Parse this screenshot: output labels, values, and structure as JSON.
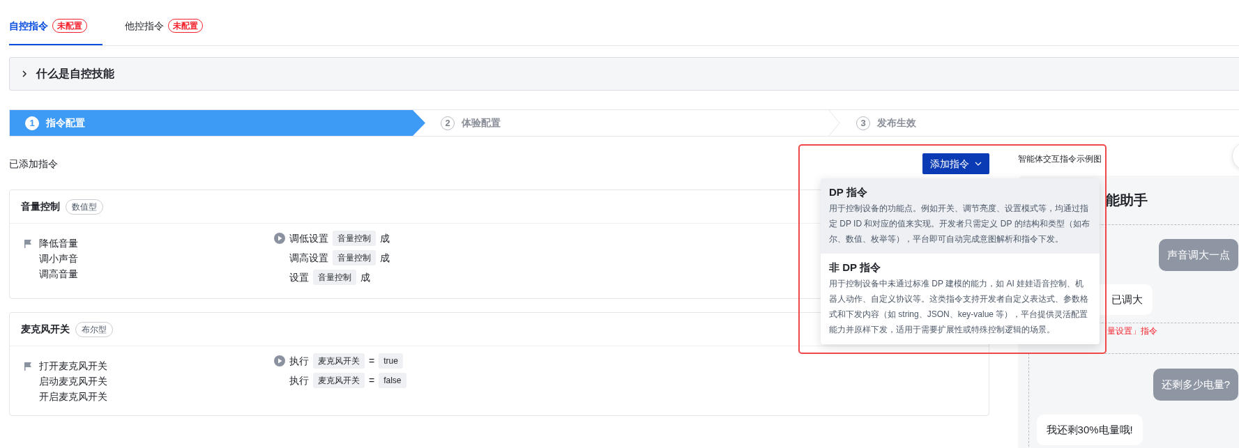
{
  "tabs": [
    {
      "label": "自控指令",
      "badge": "未配置",
      "selected": true
    },
    {
      "label": "他控指令",
      "badge": "未配置",
      "selected": false
    }
  ],
  "collapse": {
    "title": "什么是自控技能",
    "expanded": false
  },
  "steps": [
    {
      "number": "1",
      "label": "指令配置",
      "selected": true
    },
    {
      "number": "2",
      "label": "体验配置",
      "selected": false
    },
    {
      "number": "3",
      "label": "发布生效",
      "selected": false
    }
  ],
  "section_title": "已添加指令",
  "add_button": {
    "label": "添加指令"
  },
  "commands": [
    {
      "name": "音量控制",
      "type": "数值型",
      "utterances": [
        "降低音量",
        "调小声音",
        "调高音量"
      ],
      "actions": [
        [
          {
            "kind": "text",
            "text": "调低设置"
          },
          {
            "kind": "chip",
            "text": "音量控制"
          },
          {
            "kind": "text",
            "text": "成"
          }
        ],
        [
          {
            "kind": "text",
            "text": "调高设置"
          },
          {
            "kind": "chip",
            "text": "音量控制"
          },
          {
            "kind": "text",
            "text": "成"
          }
        ],
        [
          {
            "kind": "text",
            "text": "设置"
          },
          {
            "kind": "chip",
            "text": "音量控制"
          },
          {
            "kind": "text",
            "text": "成"
          }
        ]
      ]
    },
    {
      "name": "麦克风开关",
      "type": "布尔型",
      "utterances": [
        "打开麦克风开关",
        "启动麦克风开关",
        "开启麦克风开关"
      ],
      "actions": [
        [
          {
            "kind": "text",
            "text": "执行"
          },
          {
            "kind": "chip",
            "text": "麦克风开关"
          },
          {
            "kind": "op",
            "text": "="
          },
          {
            "kind": "chip",
            "text": "true"
          }
        ],
        [
          {
            "kind": "text",
            "text": "执行"
          },
          {
            "kind": "chip",
            "text": "麦克风开关"
          },
          {
            "kind": "op",
            "text": "="
          },
          {
            "kind": "chip",
            "text": "false"
          }
        ]
      ]
    }
  ],
  "dropdown": [
    {
      "title": "DP 指令",
      "description": "用于控制设备的功能点。例如开关、调节亮度、设置模式等，均通过指定 DP ID 和对应的值来实现。开发者只需定义 DP 的结构和类型（如布尔、数值、枚举等），平台即可自动完成意图解析和指令下发。",
      "selected": true
    },
    {
      "title": "非 DP 指令",
      "description": "用于控制设备中未通过标准 DP 建模的能力，如 AI 娃娃语音控制、机器人动作、自定义协议等。这类指令支持开发者自定义表达式、参数格式和下发内容（如 string、JSON、key-value 等），平台提供灵活配置能力并原样下发，适用于需要扩展性或特殊控制逻辑的场景。",
      "selected": false
    }
  ],
  "preview": {
    "caption": "智能体交互指令示例图",
    "title": "能助手",
    "groups": [
      {
        "messages": [
          {
            "kind": "user",
            "text": "声音调大一点"
          },
          {
            "kind": "bot",
            "text": "已调大"
          }
        ],
        "note": "量设置」指令"
      },
      {
        "messages": [
          {
            "kind": "user",
            "text": "还剩多少电量?"
          },
          {
            "kind": "bot",
            "text": "我还剩30%电量哦!"
          }
        ]
      }
    ]
  }
}
